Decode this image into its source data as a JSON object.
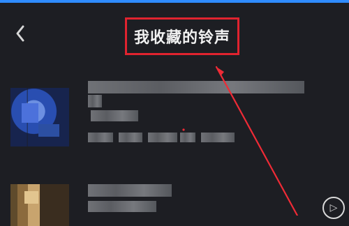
{
  "header": {
    "title": "我收藏的铃声"
  },
  "colors": {
    "background": "#1d1e23",
    "highlight_box": "#e0232f",
    "top_strip": "#2f8cff"
  },
  "icons": {
    "back": "chevron-left-icon",
    "play": "play-circle-icon"
  }
}
